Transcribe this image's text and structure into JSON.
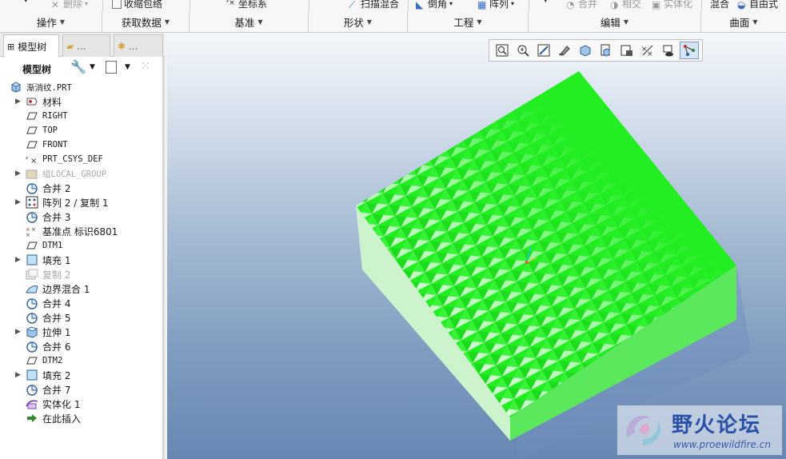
{
  "ribbon": {
    "commands": [
      {
        "label": "删除",
        "disabled": true
      },
      {
        "label": "收缩包络",
        "disabled": false
      },
      {
        "label": "坐标系",
        "disabled": false
      },
      {
        "label": "扫描混合",
        "disabled": false
      },
      {
        "label": "倒角",
        "disabled": false
      },
      {
        "label": "阵列",
        "disabled": false
      },
      {
        "label": "合并",
        "disabled": true
      },
      {
        "label": "相交",
        "disabled": true
      },
      {
        "label": "实体化",
        "disabled": true
      },
      {
        "label": "混合",
        "disabled": false
      },
      {
        "label": "自由式",
        "disabled": false
      }
    ],
    "groups": [
      "操作",
      "获取数据",
      "基准",
      "形状",
      "工程",
      "编辑",
      "曲面"
    ]
  },
  "panel": {
    "tab_model_tree": "模型树",
    "tab_2": "...",
    "tab_3": "...",
    "toolbar_label": "模型树"
  },
  "tree": {
    "root": "渐消纹.PRT",
    "items": [
      {
        "label": "材料",
        "expandable": true,
        "icon": "material-icon",
        "mono": false,
        "dim": false
      },
      {
        "label": "RIGHT",
        "expandable": false,
        "icon": "datum-plane-icon",
        "mono": true,
        "dim": false
      },
      {
        "label": "TOP",
        "expandable": false,
        "icon": "datum-plane-icon",
        "mono": true,
        "dim": false
      },
      {
        "label": "FRONT",
        "expandable": false,
        "icon": "datum-plane-icon",
        "mono": true,
        "dim": false
      },
      {
        "label": "PRT_CSYS_DEF",
        "expandable": false,
        "icon": "csys-icon",
        "mono": true,
        "dim": false
      },
      {
        "label": "组LOCAL_GROUP",
        "expandable": true,
        "icon": "group-icon",
        "mono": true,
        "dim": true
      },
      {
        "label": "合并 2",
        "expandable": false,
        "icon": "merge-icon",
        "mono": false,
        "dim": false
      },
      {
        "label": "阵列 2 / 复制 1",
        "expandable": true,
        "icon": "pattern-icon",
        "mono": false,
        "dim": false
      },
      {
        "label": "合并 3",
        "expandable": false,
        "icon": "merge-icon",
        "mono": false,
        "dim": false
      },
      {
        "label": "基准点 标识6801",
        "expandable": false,
        "icon": "datum-point-icon",
        "mono": false,
        "dim": false
      },
      {
        "label": "DTM1",
        "expandable": false,
        "icon": "datum-plane-icon",
        "mono": true,
        "dim": false
      },
      {
        "label": "填充 1",
        "expandable": true,
        "icon": "fill-icon",
        "mono": false,
        "dim": false
      },
      {
        "label": "复制 2",
        "expandable": false,
        "icon": "copy-icon",
        "mono": false,
        "dim": true
      },
      {
        "label": "边界混合 1",
        "expandable": false,
        "icon": "boundary-blend-icon",
        "mono": false,
        "dim": false
      },
      {
        "label": "合并 4",
        "expandable": false,
        "icon": "merge-icon",
        "mono": false,
        "dim": false
      },
      {
        "label": "合并 5",
        "expandable": false,
        "icon": "merge-icon",
        "mono": false,
        "dim": false
      },
      {
        "label": "拉伸 1",
        "expandable": true,
        "icon": "extrude-icon",
        "mono": false,
        "dim": false
      },
      {
        "label": "合并 6",
        "expandable": false,
        "icon": "merge-icon",
        "mono": false,
        "dim": false
      },
      {
        "label": "DTM2",
        "expandable": false,
        "icon": "datum-plane-icon",
        "mono": true,
        "dim": false
      },
      {
        "label": "填充 2",
        "expandable": true,
        "icon": "fill-icon",
        "mono": false,
        "dim": false
      },
      {
        "label": "合并 7",
        "expandable": false,
        "icon": "merge-icon",
        "mono": false,
        "dim": false
      },
      {
        "label": "实体化 1",
        "expandable": false,
        "icon": "solidify-icon",
        "mono": false,
        "dim": false
      },
      {
        "label": "在此插入",
        "expandable": false,
        "icon": "insert-arrow-icon",
        "mono": false,
        "dim": false
      }
    ]
  },
  "view_toolbar": [
    "refit-icon",
    "zoom-in-icon",
    "zoom-out-icon",
    "repaint-icon",
    "display-style-icon",
    "saved-views-icon",
    "view-manager-icon",
    "datum-display-icon",
    "annotation-display-icon",
    "spin-center-icon"
  ],
  "watermark": {
    "title": "野火论坛",
    "url": "www.proewildfire.cn"
  },
  "colors": {
    "model_green": "#22ee22",
    "model_side": "#d8f7d8",
    "model_front": "#5ce85c"
  }
}
